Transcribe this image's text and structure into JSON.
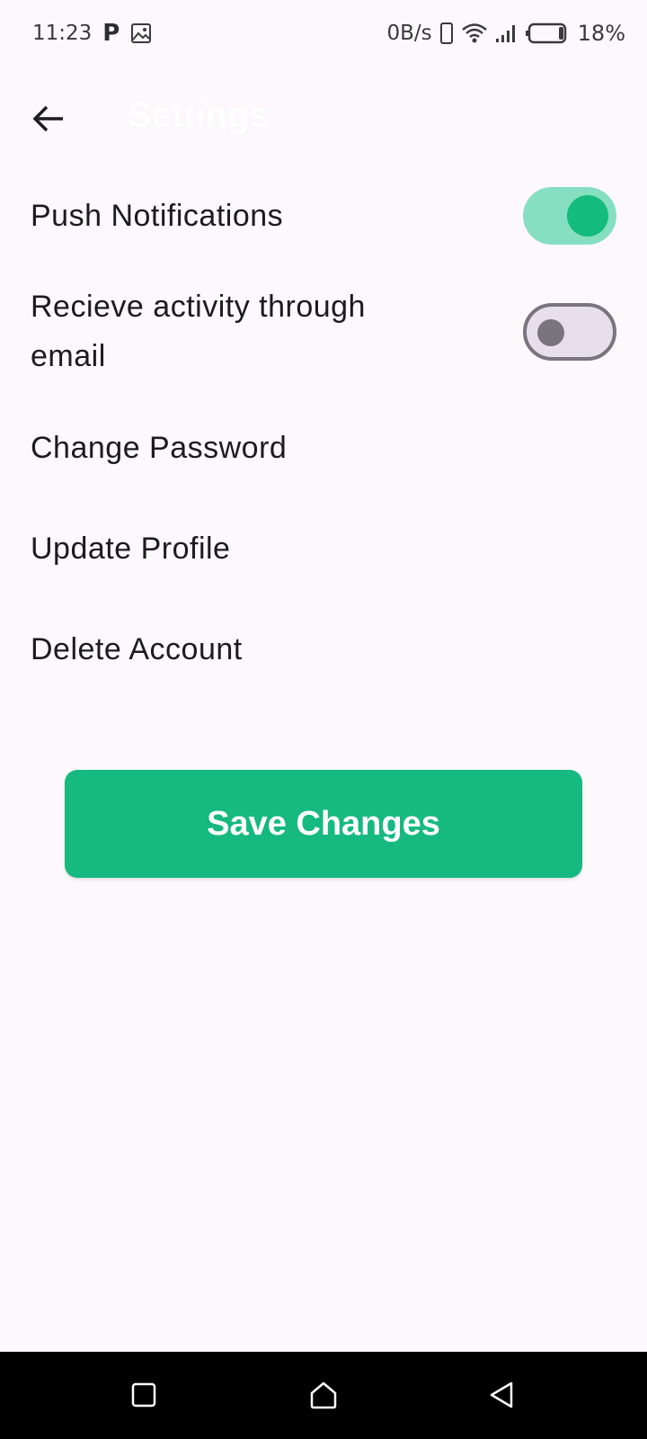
{
  "status_bar": {
    "time": "11:23",
    "p_icon_label": "P",
    "network_speed": "0B/s",
    "battery_percent": "18%",
    "icons": [
      "parking-icon",
      "image-icon",
      "phone-icon",
      "wifi-icon",
      "signal-icon",
      "battery-icon"
    ]
  },
  "app_bar": {
    "back_icon": "arrow-left-icon",
    "title": "Settings"
  },
  "settings": {
    "push_notifications": {
      "label": "Push Notifications",
      "enabled": true
    },
    "email_activity": {
      "label": "Recieve activity through email",
      "enabled": false
    },
    "change_password": {
      "label": "Change Password"
    },
    "update_profile": {
      "label": "Update Profile"
    },
    "delete_account": {
      "label": "Delete Account"
    }
  },
  "save_button": {
    "label": "Save Changes"
  },
  "colors": {
    "background": "#fdf8fc",
    "accent": "#16b980",
    "toggle_on_track": "#85dfc0",
    "toggle_off_track": "#e7e0ec",
    "toggle_off_outline": "#79747e"
  },
  "nav_bar": {
    "icons": [
      "recents-square-icon",
      "home-icon",
      "back-triangle-icon"
    ]
  }
}
